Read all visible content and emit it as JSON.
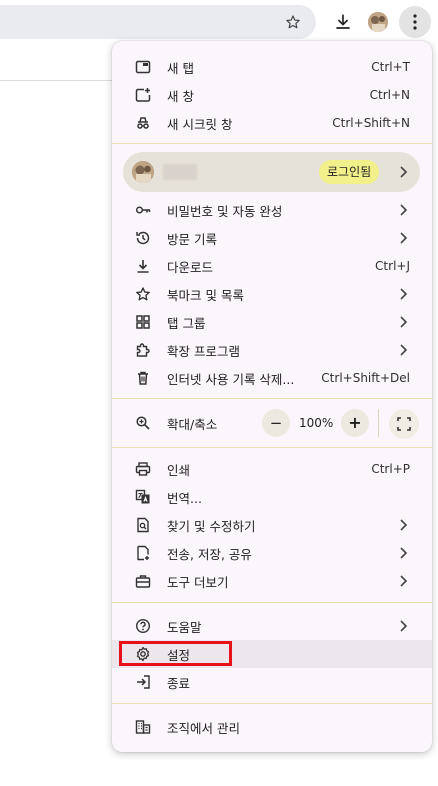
{
  "colors": {
    "menu_bg": "#fbf6fb",
    "separator": "#e8dfb0",
    "signin_pill": "#f1f08a",
    "profile_bg": "#e6e2d9",
    "highlight_red": "#e8101a"
  },
  "toolbar": {
    "icons": [
      "star-icon",
      "download-icon",
      "avatar",
      "more-vert-icon"
    ]
  },
  "menu": {
    "new_tab": {
      "label": "새 탭",
      "shortcut": "Ctrl+T",
      "icon": "new-tab-icon"
    },
    "new_window": {
      "label": "새 창",
      "shortcut": "Ctrl+N",
      "icon": "new-window-icon"
    },
    "incognito": {
      "label": "새 시크릿 창",
      "shortcut": "Ctrl+Shift+N",
      "icon": "incognito-icon"
    },
    "profile": {
      "signin_label": "로그인됨"
    },
    "passwords": {
      "label": "비밀번호 및 자동 완성",
      "icon": "key-icon"
    },
    "history": {
      "label": "방문 기록",
      "icon": "history-icon"
    },
    "downloads": {
      "label": "다운로드",
      "shortcut": "Ctrl+J",
      "icon": "download-icon"
    },
    "bookmarks": {
      "label": "북마크 및 목록",
      "icon": "star-icon"
    },
    "tab_groups": {
      "label": "탭 그룹",
      "icon": "tab-groups-icon"
    },
    "extensions": {
      "label": "확장 프로그램",
      "icon": "extension-icon"
    },
    "clear_data": {
      "label": "인터넷 사용 기록 삭제...",
      "shortcut": "Ctrl+Shift+Del",
      "icon": "trash-icon"
    },
    "zoom": {
      "label": "확대/축소",
      "value": "100%",
      "minus": "−",
      "plus": "+",
      "icon": "zoom-icon"
    },
    "print": {
      "label": "인쇄",
      "shortcut": "Ctrl+P",
      "icon": "print-icon"
    },
    "translate": {
      "label": "번역...",
      "icon": "translate-icon"
    },
    "find": {
      "label": "찾기 및 수정하기",
      "icon": "find-icon"
    },
    "cast": {
      "label": "전송, 저장, 공유",
      "icon": "cast-save-icon"
    },
    "more_tools": {
      "label": "도구 더보기",
      "icon": "toolbox-icon"
    },
    "help": {
      "label": "도움말",
      "icon": "help-icon"
    },
    "settings": {
      "label": "설정",
      "icon": "gear-icon"
    },
    "exit": {
      "label": "종료",
      "icon": "exit-icon"
    },
    "managed": {
      "label": "조직에서 관리",
      "icon": "building-icon"
    }
  }
}
